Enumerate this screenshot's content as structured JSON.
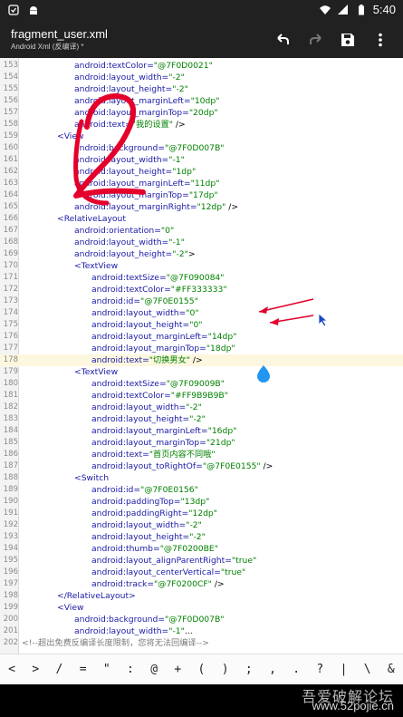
{
  "status_bar": {
    "time": "5:40"
  },
  "app_bar": {
    "title": "fragment_user.xml",
    "subtitle": "Android Xml (反编译) *",
    "actions": [
      "undo-icon",
      "redo-icon",
      "save-icon",
      "more-vert-icon"
    ]
  },
  "editor": {
    "highlighted_line": 178,
    "lines": [
      {
        "n": "153",
        "indent": 6,
        "tokens": [
          [
            "attr",
            "android:textColor="
          ],
          [
            "val",
            "\"@7F0D0021\""
          ]
        ]
      },
      {
        "n": "154",
        "indent": 6,
        "tokens": [
          [
            "attr",
            "android:layout_width="
          ],
          [
            "val",
            "\"-2\""
          ]
        ]
      },
      {
        "n": "155",
        "indent": 6,
        "tokens": [
          [
            "attr",
            "android:layout_height="
          ],
          [
            "val",
            "\"-2\""
          ]
        ]
      },
      {
        "n": "156",
        "indent": 6,
        "tokens": [
          [
            "attr",
            "android:layout_marginLeft="
          ],
          [
            "val",
            "\"10dp\""
          ]
        ]
      },
      {
        "n": "157",
        "indent": 6,
        "tokens": [
          [
            "attr",
            "android:layout_marginTop="
          ],
          [
            "val",
            "\"20dp\""
          ]
        ]
      },
      {
        "n": "158",
        "indent": 6,
        "tokens": [
          [
            "attr",
            "android:text="
          ],
          [
            "val",
            "\"我的设置\""
          ],
          [
            "pun",
            " />"
          ]
        ]
      },
      {
        "n": "159",
        "indent": 4,
        "tokens": [
          [
            "tag",
            "<View"
          ]
        ]
      },
      {
        "n": "160",
        "indent": 6,
        "tokens": [
          [
            "attr",
            "android:background="
          ],
          [
            "val",
            "\"@7F0D007B\""
          ]
        ]
      },
      {
        "n": "161",
        "indent": 6,
        "tokens": [
          [
            "attr",
            "android:layout_width="
          ],
          [
            "val",
            "\"-1\""
          ]
        ]
      },
      {
        "n": "162",
        "indent": 6,
        "tokens": [
          [
            "attr",
            "android:layout_height="
          ],
          [
            "val",
            "\"1dp\""
          ]
        ]
      },
      {
        "n": "163",
        "indent": 6,
        "tokens": [
          [
            "attr",
            "android:layout_marginLeft="
          ],
          [
            "val",
            "\"11dp\""
          ]
        ]
      },
      {
        "n": "164",
        "indent": 6,
        "tokens": [
          [
            "attr",
            "android:layout_marginTop="
          ],
          [
            "val",
            "\"17dp\""
          ]
        ]
      },
      {
        "n": "165",
        "indent": 6,
        "tokens": [
          [
            "attr",
            "android:layout_marginRight="
          ],
          [
            "val",
            "\"12dp\""
          ],
          [
            "pun",
            " />"
          ]
        ]
      },
      {
        "n": "166",
        "indent": 4,
        "tokens": [
          [
            "tag",
            "<RelativeLayout"
          ]
        ]
      },
      {
        "n": "167",
        "indent": 6,
        "tokens": [
          [
            "attr",
            "android:orientation="
          ],
          [
            "val",
            "\"0\""
          ]
        ]
      },
      {
        "n": "168",
        "indent": 6,
        "tokens": [
          [
            "attr",
            "android:layout_width="
          ],
          [
            "val",
            "\"-1\""
          ]
        ]
      },
      {
        "n": "169",
        "indent": 6,
        "tokens": [
          [
            "attr",
            "android:layout_height="
          ],
          [
            "val",
            "\"-2\""
          ],
          [
            "pun",
            ">"
          ]
        ]
      },
      {
        "n": "170",
        "indent": 6,
        "tokens": [
          [
            "tag",
            "<TextView"
          ]
        ]
      },
      {
        "n": "171",
        "indent": 8,
        "tokens": [
          [
            "attr",
            "android:textSize="
          ],
          [
            "val",
            "\"@7F090084\""
          ]
        ]
      },
      {
        "n": "172",
        "indent": 8,
        "tokens": [
          [
            "attr",
            "android:textColor="
          ],
          [
            "val",
            "\"#FF333333\""
          ]
        ]
      },
      {
        "n": "173",
        "indent": 8,
        "tokens": [
          [
            "attr",
            "android:id="
          ],
          [
            "val",
            "\"@7F0E0155\""
          ]
        ]
      },
      {
        "n": "174",
        "indent": 8,
        "tokens": [
          [
            "attr",
            "android:layout_width="
          ],
          [
            "val",
            "\"0\""
          ]
        ]
      },
      {
        "n": "175",
        "indent": 8,
        "tokens": [
          [
            "attr",
            "android:layout_height="
          ],
          [
            "val",
            "\"0\""
          ]
        ]
      },
      {
        "n": "176",
        "indent": 8,
        "tokens": [
          [
            "attr",
            "android:layout_marginLeft="
          ],
          [
            "val",
            "\"14dp\""
          ]
        ]
      },
      {
        "n": "177",
        "indent": 8,
        "tokens": [
          [
            "attr",
            "android:layout_marginTop="
          ],
          [
            "val",
            "\"18dp\""
          ]
        ]
      },
      {
        "n": "178",
        "indent": 8,
        "tokens": [
          [
            "attr",
            "android:text="
          ],
          [
            "val",
            "\"切换男女\""
          ],
          [
            "pun",
            " />"
          ]
        ]
      },
      {
        "n": "179",
        "indent": 6,
        "tokens": [
          [
            "tag",
            "<TextView"
          ]
        ]
      },
      {
        "n": "180",
        "indent": 8,
        "tokens": [
          [
            "attr",
            "android:textSize="
          ],
          [
            "val",
            "\"@7F09009B\""
          ]
        ]
      },
      {
        "n": "181",
        "indent": 8,
        "tokens": [
          [
            "attr",
            "android:textColor="
          ],
          [
            "val",
            "\"#FF9B9B9B\""
          ]
        ]
      },
      {
        "n": "182",
        "indent": 8,
        "tokens": [
          [
            "attr",
            "android:layout_width="
          ],
          [
            "val",
            "\"-2\""
          ]
        ]
      },
      {
        "n": "183",
        "indent": 8,
        "tokens": [
          [
            "attr",
            "android:layout_height="
          ],
          [
            "val",
            "\"-2\""
          ]
        ]
      },
      {
        "n": "184",
        "indent": 8,
        "tokens": [
          [
            "attr",
            "android:layout_marginLeft="
          ],
          [
            "val",
            "\"16dp\""
          ]
        ]
      },
      {
        "n": "185",
        "indent": 8,
        "tokens": [
          [
            "attr",
            "android:layout_marginTop="
          ],
          [
            "val",
            "\"21dp\""
          ]
        ]
      },
      {
        "n": "186",
        "indent": 8,
        "tokens": [
          [
            "attr",
            "android:text="
          ],
          [
            "val",
            "\"首页内容不同哦\""
          ]
        ]
      },
      {
        "n": "187",
        "indent": 8,
        "tokens": [
          [
            "attr",
            "android:layout_toRightOf="
          ],
          [
            "val",
            "\"@7F0E0155\""
          ],
          [
            "pun",
            " />"
          ]
        ]
      },
      {
        "n": "188",
        "indent": 6,
        "tokens": [
          [
            "tag",
            "<Switch"
          ]
        ]
      },
      {
        "n": "189",
        "indent": 8,
        "tokens": [
          [
            "attr",
            "android:id="
          ],
          [
            "val",
            "\"@7F0E0156\""
          ]
        ]
      },
      {
        "n": "190",
        "indent": 8,
        "tokens": [
          [
            "attr",
            "android:paddingTop="
          ],
          [
            "val",
            "\"13dp\""
          ]
        ]
      },
      {
        "n": "191",
        "indent": 8,
        "tokens": [
          [
            "attr",
            "android:paddingRight="
          ],
          [
            "val",
            "\"12dp\""
          ]
        ]
      },
      {
        "n": "192",
        "indent": 8,
        "tokens": [
          [
            "attr",
            "android:layout_width="
          ],
          [
            "val",
            "\"-2\""
          ]
        ]
      },
      {
        "n": "193",
        "indent": 8,
        "tokens": [
          [
            "attr",
            "android:layout_height="
          ],
          [
            "val",
            "\"-2\""
          ]
        ]
      },
      {
        "n": "194",
        "indent": 8,
        "tokens": [
          [
            "attr",
            "android:thumb="
          ],
          [
            "val",
            "\"@7F0200BE\""
          ]
        ]
      },
      {
        "n": "195",
        "indent": 8,
        "tokens": [
          [
            "attr",
            "android:layout_alignParentRight="
          ],
          [
            "val",
            "\"true\""
          ]
        ]
      },
      {
        "n": "196",
        "indent": 8,
        "tokens": [
          [
            "attr",
            "android:layout_centerVertical="
          ],
          [
            "val",
            "\"true\""
          ]
        ]
      },
      {
        "n": "197",
        "indent": 8,
        "tokens": [
          [
            "attr",
            "android:track="
          ],
          [
            "val",
            "\"@7F0200CF\""
          ],
          [
            "pun",
            " />"
          ]
        ]
      },
      {
        "n": "198",
        "indent": 4,
        "tokens": [
          [
            "tag",
            "</RelativeLayout>"
          ]
        ]
      },
      {
        "n": "199",
        "indent": 4,
        "tokens": [
          [
            "tag",
            "<View"
          ]
        ]
      },
      {
        "n": "200",
        "indent": 6,
        "tokens": [
          [
            "attr",
            "android:background="
          ],
          [
            "val",
            "\"@7F0D007B\""
          ]
        ]
      },
      {
        "n": "201",
        "indent": 6,
        "tokens": [
          [
            "attr",
            "android:layout_width="
          ],
          [
            "val",
            "\"-1\""
          ],
          [
            "pun",
            "..."
          ]
        ]
      },
      {
        "n": "202",
        "indent": 0,
        "tokens": [
          [
            "comment",
            "<!--超出免费反编译长度限制，您将无法回编译-->"
          ]
        ]
      }
    ]
  },
  "symbol_bar": {
    "symbols": [
      "<",
      ">",
      "/",
      "=",
      "\"",
      ":",
      "@",
      "+",
      "(",
      ")",
      ";",
      ",",
      ".",
      "?",
      "|",
      "\\",
      "&"
    ]
  },
  "watermark": {
    "top": "吾爱破解论坛",
    "bottom": "www.52pojie.cn"
  },
  "colors": {
    "app_bar": "#212121",
    "attr": "#1a1aa6",
    "value": "#008000",
    "annotation": "#e4002b",
    "cursor": "#2196f3",
    "highlight": "#fdf7df"
  }
}
